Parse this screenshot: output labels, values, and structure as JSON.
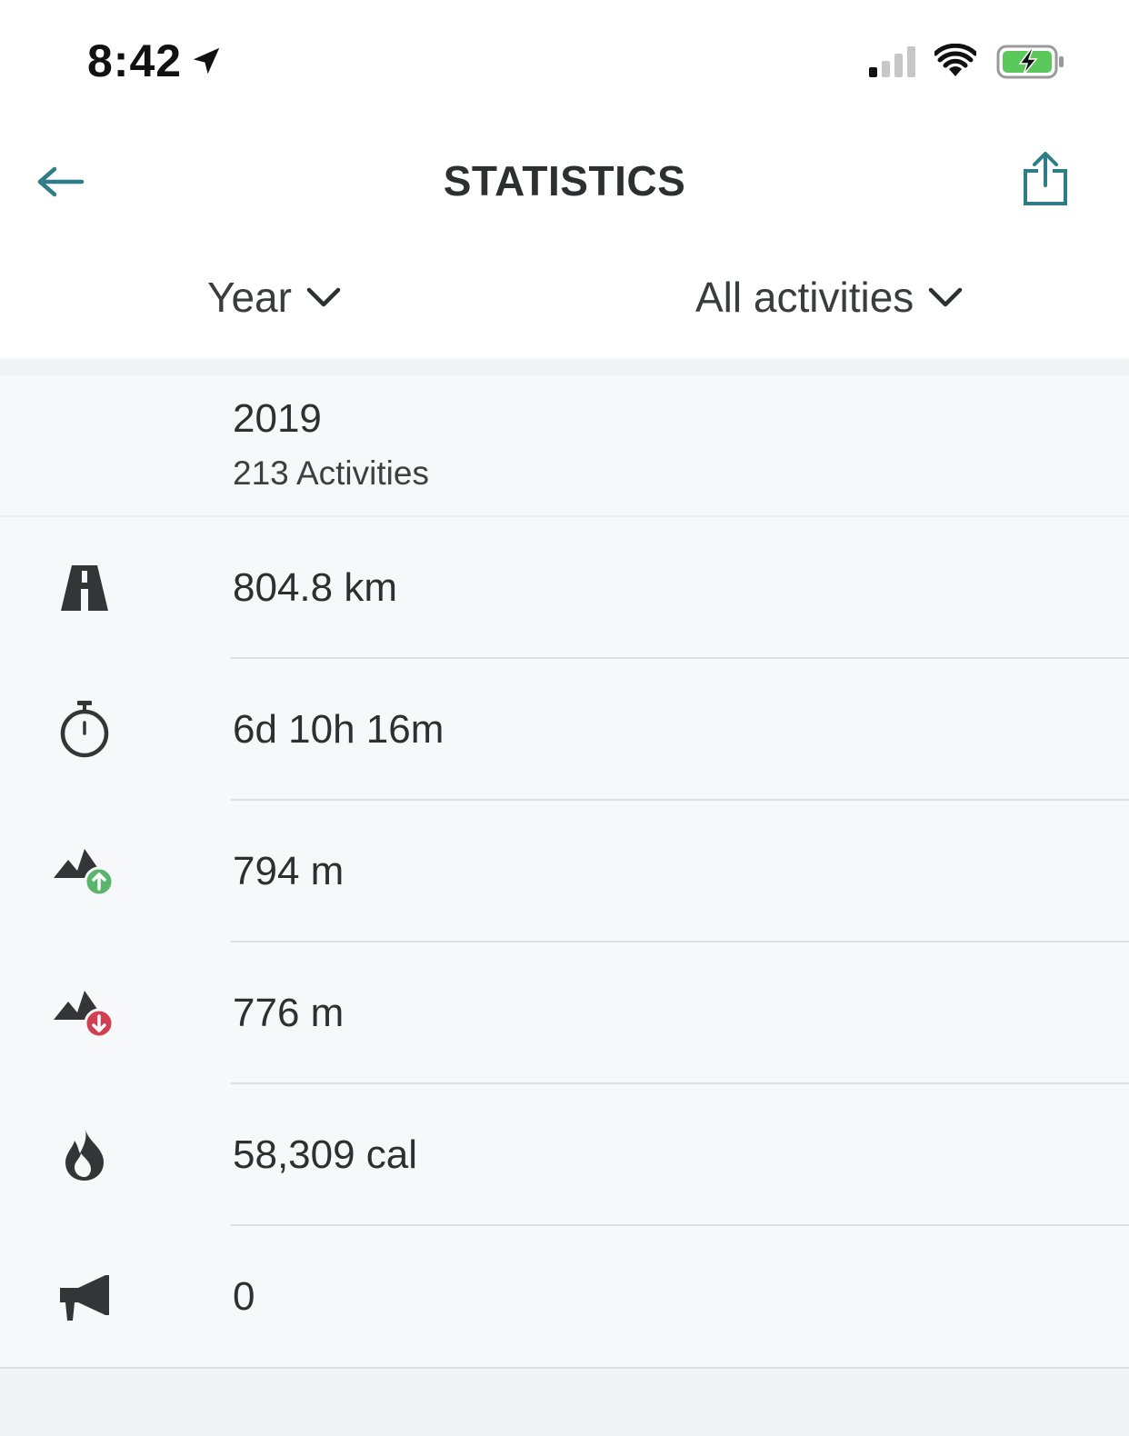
{
  "status_bar": {
    "time": "8:42"
  },
  "header": {
    "title": "STATISTICS"
  },
  "filters": {
    "period": "Year",
    "activity": "All activities"
  },
  "summary": {
    "year": "2019",
    "activities": "213 Activities"
  },
  "stats": [
    {
      "icon": "road-icon",
      "value": "804.8 km"
    },
    {
      "icon": "stopwatch-icon",
      "value": "6d 10h 16m"
    },
    {
      "icon": "elevation-gain-icon",
      "value": "794 m"
    },
    {
      "icon": "elevation-loss-icon",
      "value": "776 m"
    },
    {
      "icon": "flame-icon",
      "value": "58,309 cal"
    },
    {
      "icon": "megaphone-icon",
      "value": "0"
    }
  ],
  "colors": {
    "accent": "#2e7d86",
    "gain": "#5ab46a",
    "loss": "#d14050",
    "icon": "#333537"
  }
}
